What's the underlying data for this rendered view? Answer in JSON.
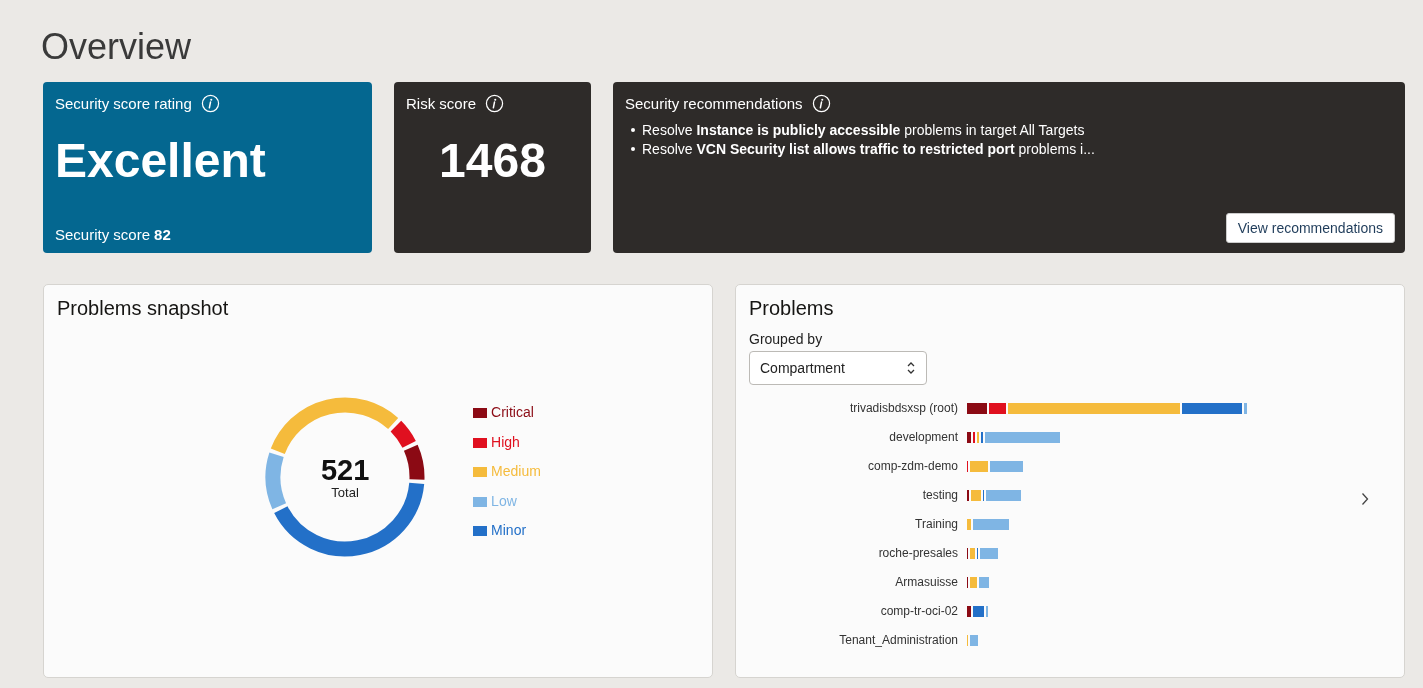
{
  "page_title": "Overview",
  "score_card": {
    "title": "Security score rating",
    "rating": "Excellent",
    "score_label": "Security score",
    "score": "82"
  },
  "risk_card": {
    "title": "Risk score",
    "value": "1468"
  },
  "recommendations": {
    "title": "Security recommendations",
    "items": [
      "Resolve **Instance is publicly accessible** problems in target All Targets",
      "Resolve **VCN Security list allows traffic to restricted port** problems i..."
    ],
    "button": "View recommendations"
  },
  "snapshot": {
    "title": "Problems snapshot",
    "total": "521",
    "total_label": "Total",
    "legend": [
      {
        "label": "Critical",
        "color": "#8b0a14"
      },
      {
        "label": "High",
        "color": "#e0101f"
      },
      {
        "label": "Medium",
        "color": "#f5bb3c"
      },
      {
        "label": "Low",
        "color": "#7fb5e4"
      },
      {
        "label": "Minor",
        "color": "#2370c8"
      }
    ]
  },
  "problems": {
    "title": "Problems",
    "group_label": "Grouped by",
    "group_value": "Compartment",
    "rows": [
      "trivadisbdsxsp (root)",
      "development",
      "comp-zdm-demo",
      "testing",
      "Training",
      "roche-presales",
      "Armasuisse",
      "comp-tr-oci-02",
      "Tenant_Administration"
    ]
  }
}
